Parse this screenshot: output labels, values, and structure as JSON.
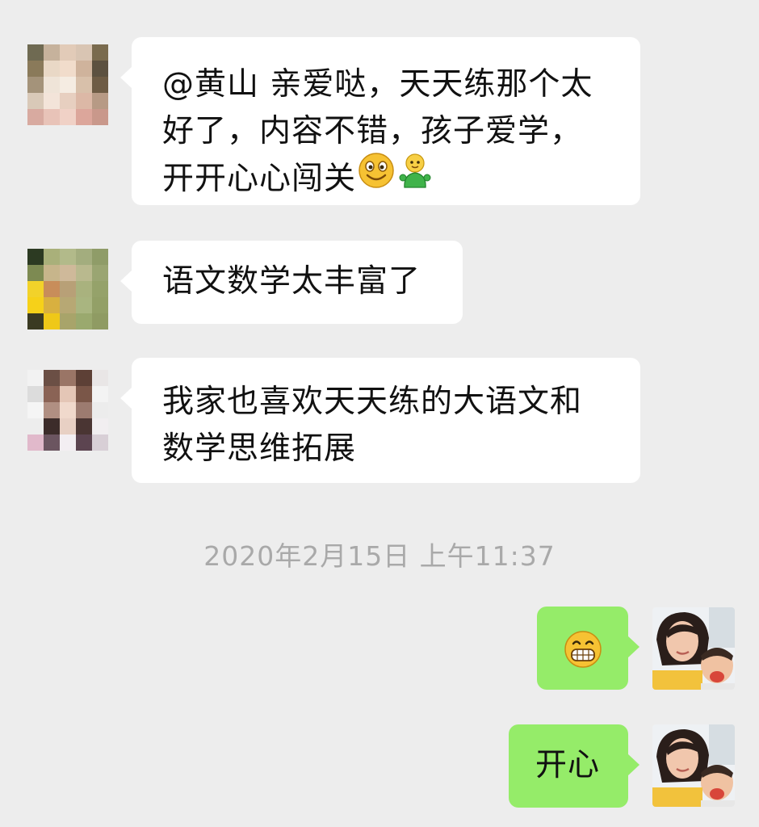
{
  "messages": [
    {
      "text": "@黄山 亲爱哒，天天练那个太\n好了，内容不错，孩子爱学，\n开开心心闯关",
      "emojis": [
        "smile-emoji",
        "doll-emoji"
      ]
    },
    {
      "text": "语文数学太丰富了"
    },
    {
      "text": "我家也喜欢天天练的大语文和\n数学思维拓展"
    }
  ],
  "timestamp": "2020年2月15日 上午11:37",
  "own_messages": [
    {
      "emoji": "grin-emoji"
    },
    {
      "text": "开心"
    }
  ],
  "colors": {
    "background": "#ededed",
    "incoming_bubble": "#ffffff",
    "outgoing_bubble": "#95ec69",
    "timestamp_text": "#a9a9a9"
  }
}
